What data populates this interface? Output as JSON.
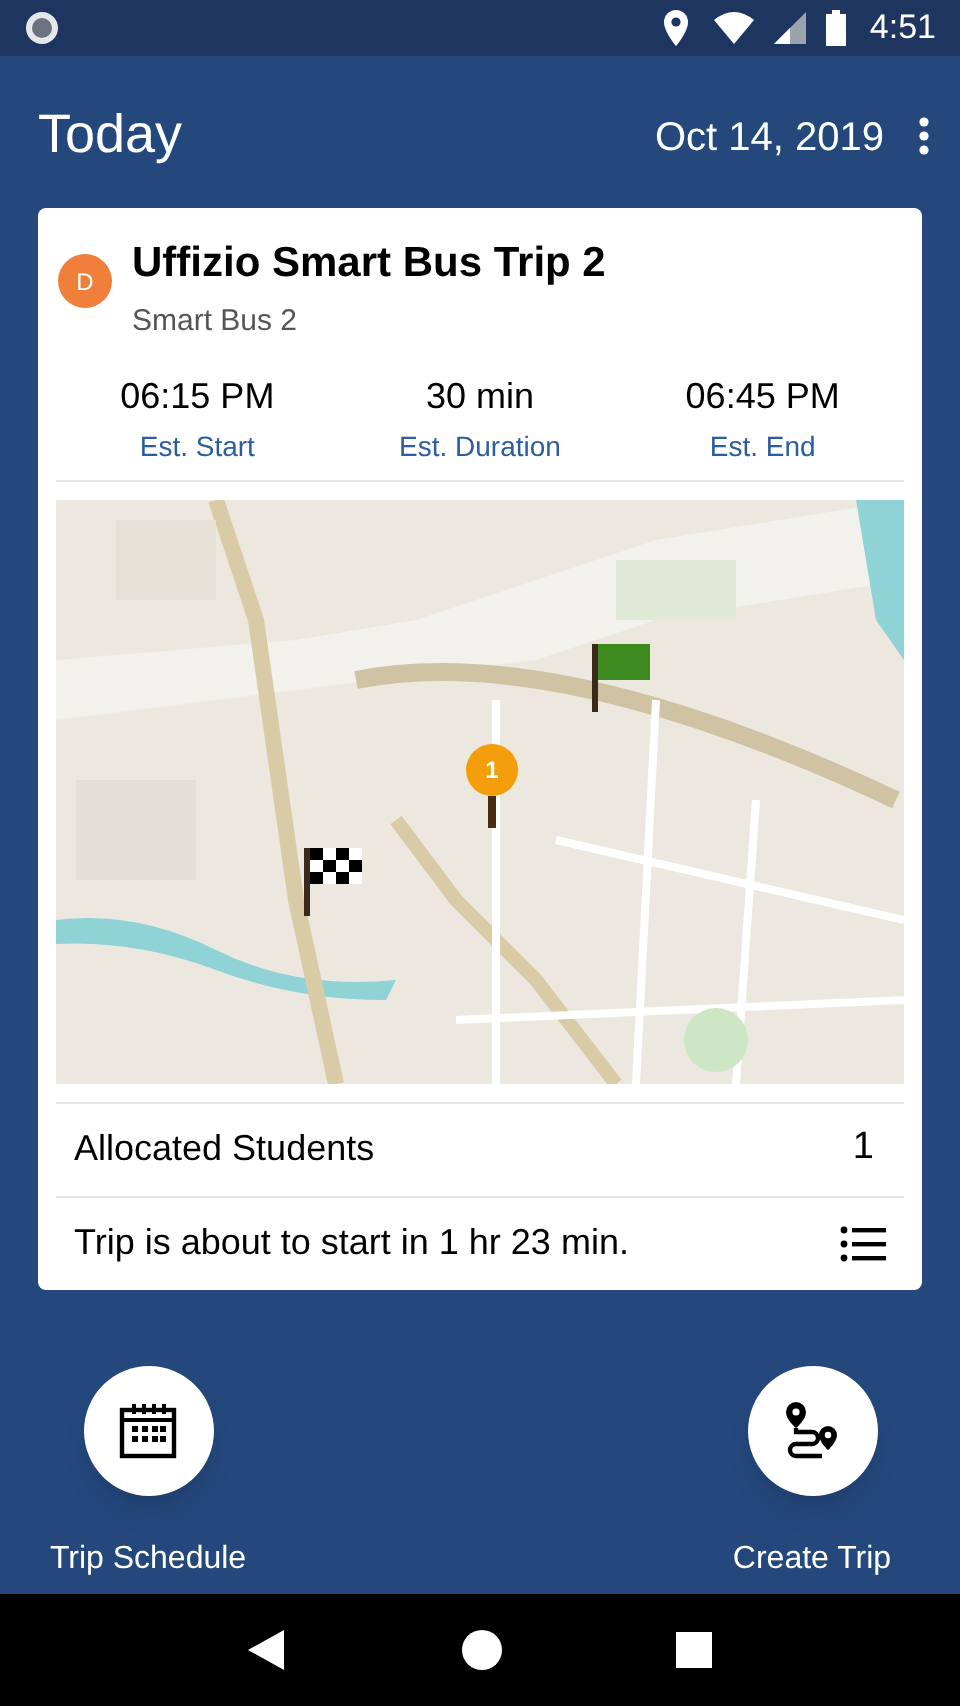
{
  "status_bar": {
    "time": "4:51"
  },
  "header": {
    "title": "Today",
    "date": "Oct 14, 2019"
  },
  "trip": {
    "avatar": "D",
    "title": "Uffizio Smart Bus Trip 2",
    "vehicle": "Smart Bus 2",
    "stats": [
      {
        "value": "06:15 PM",
        "label": "Est. Start"
      },
      {
        "value": "30 min",
        "label": "Est. Duration"
      },
      {
        "value": "06:45 PM",
        "label": "Est. End"
      }
    ],
    "map": {
      "kind": "picture",
      "stop_marker": "1"
    },
    "allocated": {
      "label": "Allocated Students",
      "value": "1"
    },
    "notice": "Trip is about to start in 1 hr 23 min."
  },
  "actions": [
    {
      "kind": "schedule",
      "label": "Trip Schedule"
    },
    {
      "kind": "create",
      "label": "Create Trip"
    }
  ]
}
